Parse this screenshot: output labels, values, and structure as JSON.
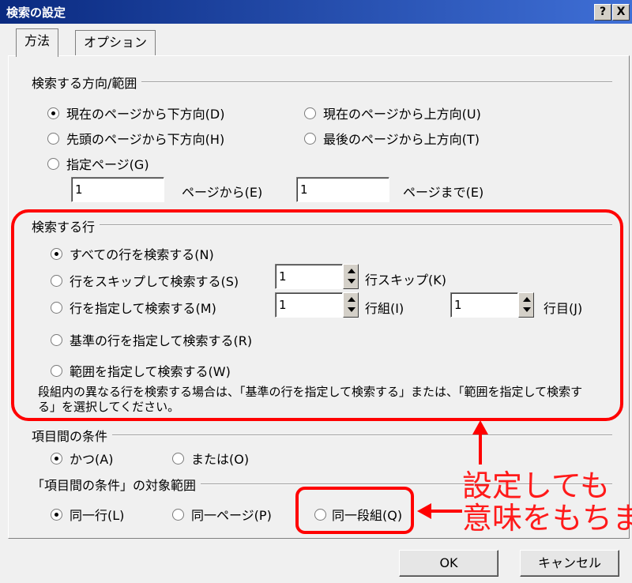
{
  "window": {
    "title": "検索の設定",
    "help_label": "?",
    "close_label": "X"
  },
  "tabs": [
    {
      "label": "方法",
      "active": true
    },
    {
      "label": "オプション",
      "active": false
    }
  ],
  "direction_group": {
    "title": "検索する方向/範囲",
    "options": [
      {
        "label": "現在のページから下方向(D)",
        "selected": true
      },
      {
        "label": "現在のページから上方向(U)",
        "selected": false
      },
      {
        "label": "先頭のページから下方向(H)",
        "selected": false
      },
      {
        "label": "最後のページから上方向(T)",
        "selected": false
      },
      {
        "label": "指定ページ(G)",
        "selected": false
      }
    ],
    "page_from_value": "1",
    "page_from_label": "ページから(E)",
    "page_to_value": "1",
    "page_to_label": "ページまで(E)"
  },
  "rows_group": {
    "title": "検索する行",
    "options": [
      {
        "label": "すべての行を検索する(N)",
        "selected": true
      },
      {
        "label": "行をスキップして検索する(S)",
        "selected": false
      },
      {
        "label": "行を指定して検索する(M)",
        "selected": false
      },
      {
        "label": "基準の行を指定して検索する(R)",
        "selected": false
      },
      {
        "label": "範囲を指定して検索する(W)",
        "selected": false
      }
    ],
    "skip_value": "1",
    "skip_label": "行スキップ(K)",
    "group_value": "1",
    "group_label": "行組(I)",
    "row_value": "1",
    "row_label": "行目(J)",
    "note": "段組内の異なる行を検索する場合は、「基準の行を指定して検索する」または、「範囲を指定して検索する」を選択してください。"
  },
  "condition_group": {
    "title": "項目間の条件",
    "options": [
      {
        "label": "かつ(A)",
        "selected": true
      },
      {
        "label": "または(O)",
        "selected": false
      }
    ]
  },
  "scope_group": {
    "title": "「項目間の条件」の対象範囲",
    "options": [
      {
        "label": "同一行(L)",
        "selected": true
      },
      {
        "label": "同一ページ(P)",
        "selected": false
      },
      {
        "label": "同一段組(Q)",
        "selected": false
      }
    ]
  },
  "buttons": {
    "ok": "OK",
    "cancel": "キャンセル"
  },
  "annotation": {
    "line1": "設定しても",
    "line2": "意味をもちません"
  },
  "colors": {
    "annotation": "#ff0000",
    "titlebar": "#0a2a80"
  }
}
